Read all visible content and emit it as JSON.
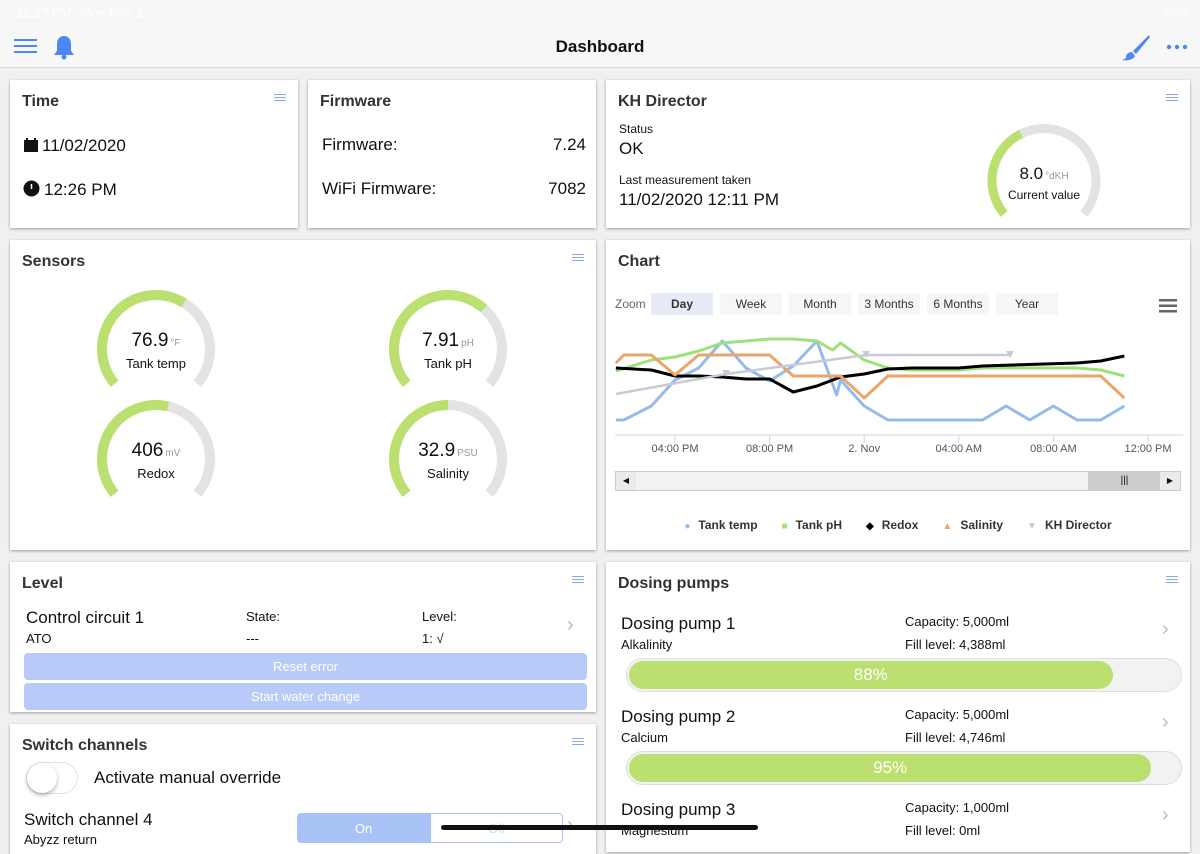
{
  "status_bar": {
    "time": "12:27 PM",
    "date": "Mon Nov 2",
    "battery": "99%"
  },
  "header": {
    "title": "Dashboard"
  },
  "colors": {
    "accent": "#4f86f7",
    "gauge_fill": "#bce06f",
    "gauge_track": "#e3e3e3",
    "button": "#b8cbf8"
  },
  "time_card": {
    "title": "Time",
    "date": "11/02/2020",
    "time": "12:26 PM"
  },
  "firmware_card": {
    "title": "Firmware",
    "rows": [
      {
        "label": "Firmware:",
        "value": "7.24"
      },
      {
        "label": "WiFi Firmware:",
        "value": "7082"
      }
    ]
  },
  "kh_card": {
    "title": "KH Director",
    "status_label": "Status",
    "status": "OK",
    "last_label": "Last measurement taken",
    "last": "11/02/2020 12:11 PM",
    "gauge": {
      "value": "8.0",
      "unit": "°dKH",
      "label": "Current value",
      "fill_percent": 40
    }
  },
  "sensors_card": {
    "title": "Sensors",
    "gauges": [
      {
        "value": "76.9",
        "unit": "°F",
        "label": "Tank temp",
        "fill_percent": 62
      },
      {
        "value": "7.91",
        "unit": "pH",
        "label": "Tank pH",
        "fill_percent": 66
      },
      {
        "value": "406",
        "unit": "mV",
        "label": "Redox",
        "fill_percent": 55
      },
      {
        "value": "32.9",
        "unit": "PSU",
        "label": "Salinity",
        "fill_percent": 50
      }
    ]
  },
  "chart_card": {
    "title": "Chart",
    "zoom_label": "Zoom",
    "zoom_options": [
      "Day",
      "Week",
      "Month",
      "3 Months",
      "6 Months",
      "Year"
    ],
    "selected_zoom": "Day"
  },
  "chart_data": {
    "type": "line",
    "xlabel": "",
    "ylabel": "",
    "grid": false,
    "legend": "bottom",
    "x_ticks": [
      "04:00 PM",
      "08:00 PM",
      "2. Nov",
      "04:00 AM",
      "08:00 AM",
      "12:00 PM"
    ],
    "series": [
      {
        "name": "Tank temp",
        "color": "#94bbea",
        "marker": "circle",
        "points": [
          [
            "2020-11-01T13:30",
            13
          ],
          [
            "2020-11-01T13:50",
            13
          ],
          [
            "2020-11-01T15:00",
            27
          ],
          [
            "2020-11-01T16:00",
            53
          ],
          [
            "2020-11-01T17:00",
            65
          ],
          [
            "2020-11-01T18:00",
            92
          ],
          [
            "2020-11-01T19:00",
            65
          ],
          [
            "2020-11-01T20:00",
            52
          ],
          [
            "2020-11-01T21:00",
            67
          ],
          [
            "2020-11-01T22:00",
            92
          ],
          [
            "2020-11-01T22:50",
            38
          ],
          [
            "2020-11-01T23:00",
            53
          ],
          [
            "2020-11-02T00:00",
            27
          ],
          [
            "2020-11-02T01:00",
            13
          ],
          [
            "2020-11-02T05:00",
            13
          ],
          [
            "2020-11-02T06:00",
            27
          ],
          [
            "2020-11-02T07:00",
            13
          ],
          [
            "2020-11-02T08:00",
            27
          ],
          [
            "2020-11-02T09:00",
            13
          ],
          [
            "2020-11-02T10:00",
            13
          ],
          [
            "2020-11-02T11:00",
            27
          ]
        ]
      },
      {
        "name": "Tank pH",
        "color": "#9ee07a",
        "marker": "square",
        "points": [
          [
            "2020-11-01T13:30",
            62
          ],
          [
            "2020-11-01T15:00",
            73
          ],
          [
            "2020-11-01T16:00",
            76
          ],
          [
            "2020-11-01T17:00",
            82
          ],
          [
            "2020-11-01T18:00",
            90
          ],
          [
            "2020-11-01T19:00",
            92
          ],
          [
            "2020-11-01T20:00",
            94
          ],
          [
            "2020-11-01T21:00",
            94
          ],
          [
            "2020-11-01T22:00",
            92
          ],
          [
            "2020-11-01T22:40",
            83
          ],
          [
            "2020-11-01T23:00",
            90
          ],
          [
            "2020-11-02T00:00",
            73
          ],
          [
            "2020-11-02T01:00",
            65
          ],
          [
            "2020-11-02T02:00",
            63
          ],
          [
            "2020-11-02T04:00",
            63
          ],
          [
            "2020-11-02T05:00",
            65
          ],
          [
            "2020-11-02T09:00",
            65
          ],
          [
            "2020-11-02T10:00",
            63
          ],
          [
            "2020-11-02T11:00",
            57
          ]
        ]
      },
      {
        "name": "Redox",
        "color": "#000000",
        "marker": "diamond",
        "points": [
          [
            "2020-11-01T13:30",
            65
          ],
          [
            "2020-11-01T15:00",
            63
          ],
          [
            "2020-11-01T16:00",
            57
          ],
          [
            "2020-11-01T17:00",
            57
          ],
          [
            "2020-11-01T18:00",
            56
          ],
          [
            "2020-11-01T19:00",
            54
          ],
          [
            "2020-11-01T20:00",
            54
          ],
          [
            "2020-11-01T21:00",
            41
          ],
          [
            "2020-11-01T22:00",
            47
          ],
          [
            "2020-11-01T23:00",
            56
          ],
          [
            "2020-11-02T00:00",
            59
          ],
          [
            "2020-11-02T01:00",
            64
          ],
          [
            "2020-11-02T02:00",
            65
          ],
          [
            "2020-11-02T04:00",
            65
          ],
          [
            "2020-11-02T05:00",
            67
          ],
          [
            "2020-11-02T09:00",
            70
          ],
          [
            "2020-11-02T10:00",
            72
          ],
          [
            "2020-11-02T11:00",
            77
          ]
        ]
      },
      {
        "name": "Salinity",
        "color": "#eda469",
        "marker": "triangle",
        "points": [
          [
            "2020-11-01T13:30",
            70
          ],
          [
            "2020-11-01T13:50",
            78
          ],
          [
            "2020-11-01T15:00",
            78
          ],
          [
            "2020-11-01T16:00",
            58
          ],
          [
            "2020-11-01T17:00",
            78
          ],
          [
            "2020-11-01T20:00",
            78
          ],
          [
            "2020-11-01T21:00",
            57
          ],
          [
            "2020-11-01T23:00",
            57
          ],
          [
            "2020-11-02T00:00",
            35
          ],
          [
            "2020-11-02T01:00",
            57
          ],
          [
            "2020-11-02T10:00",
            57
          ],
          [
            "2020-11-02T11:00",
            35
          ]
        ]
      },
      {
        "name": "KH Director",
        "color": "#c9cad8",
        "marker": "triangle-down",
        "points": [
          [
            "2020-11-01T13:30",
            39
          ],
          [
            "2020-11-01T18:10",
            59
          ],
          [
            "2020-11-02T00:05",
            78
          ],
          [
            "2020-11-02T06:10",
            78
          ]
        ]
      }
    ]
  },
  "level_card": {
    "title": "Level",
    "circuit": "Control circuit 1",
    "subtitle": "ATO",
    "state_label": "State:",
    "state": "---",
    "level_label": "Level:",
    "level": "1: √",
    "reset_label": "Reset error",
    "water_change_label": "Start water change"
  },
  "switch_card": {
    "title": "Switch channels",
    "override_label": "Activate manual override",
    "override_on": false,
    "channel": "Switch channel 4",
    "channel_sub": "Abyzz return",
    "on_label": "On",
    "off_label": "Off"
  },
  "dosing_card": {
    "title": "Dosing pumps",
    "pumps": [
      {
        "name": "Dosing pump 1",
        "sub": "Alkalinity",
        "capacity": "Capacity: 5,000ml",
        "fill": "Fill level: 4,388ml",
        "percent_label": "88%",
        "percent": 88
      },
      {
        "name": "Dosing pump 2",
        "sub": "Calcium",
        "capacity": "Capacity: 5,000ml",
        "fill": "Fill level: 4,746ml",
        "percent_label": "95%",
        "percent": 95
      },
      {
        "name": "Dosing pump 3",
        "sub": "Magnesium",
        "capacity": "Capacity: 1,000ml",
        "fill": "Fill level: 0ml"
      }
    ]
  }
}
